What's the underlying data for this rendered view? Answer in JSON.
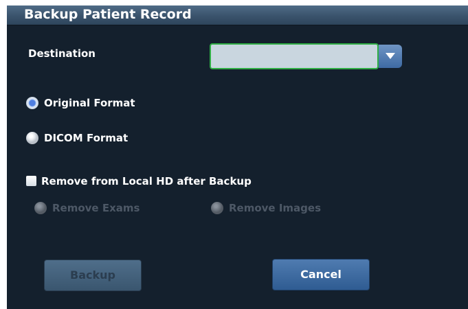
{
  "window": {
    "title": "Backup Patient Record"
  },
  "destination": {
    "label": "Destination",
    "value": ""
  },
  "format": {
    "options": [
      {
        "label": "Original Format",
        "selected": true
      },
      {
        "label": "DICOM Format",
        "selected": false
      }
    ]
  },
  "remove_from_hd": {
    "label": "Remove from Local HD after Backup",
    "checked": false,
    "options": [
      {
        "label": "Remove Exams",
        "enabled": false
      },
      {
        "label": "Remove Images",
        "enabled": false
      }
    ]
  },
  "buttons": {
    "backup_label": "Backup",
    "cancel_label": "Cancel",
    "backup_enabled": false
  },
  "colors": {
    "dialog_bg": "#14202d",
    "title_bar": "#3a536c",
    "focus_border": "#2fae44",
    "disabled_text": "#4d5866"
  }
}
